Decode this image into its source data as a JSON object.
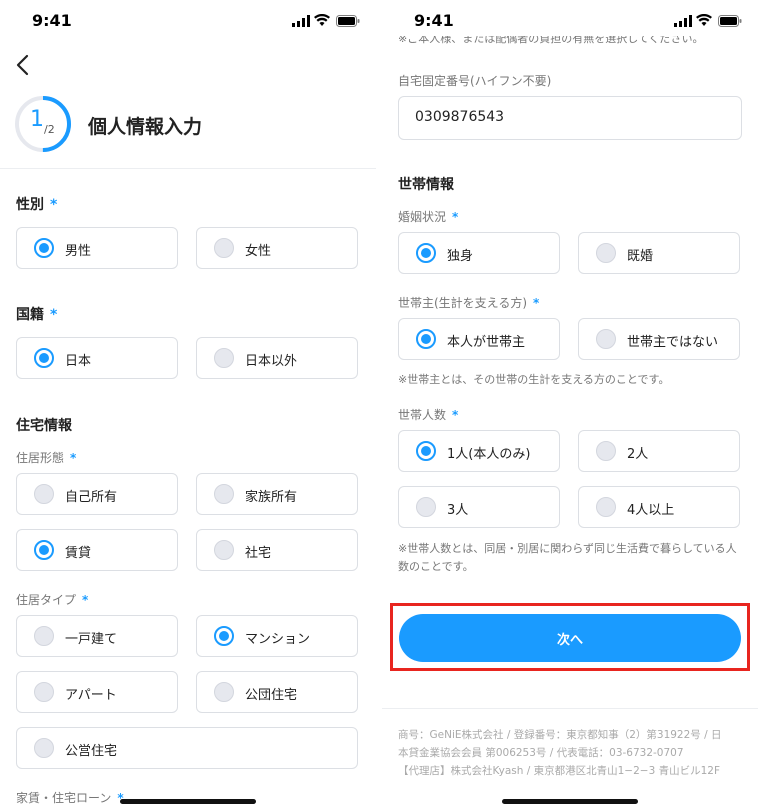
{
  "status": {
    "time": "9:41"
  },
  "left": {
    "progress": {
      "current": "1",
      "total": "/2",
      "fraction": 0.5
    },
    "page_title": "個人情報入力",
    "gender": {
      "label": "性別",
      "required": "*",
      "options": [
        "男性",
        "女性"
      ],
      "selected": 0
    },
    "nationality": {
      "label": "国籍",
      "required": "*",
      "options": [
        "日本",
        "日本以外"
      ],
      "selected": 0
    },
    "housing_section": "住宅情報",
    "residence_form": {
      "label": "住居形態",
      "required": "*",
      "options": [
        "自己所有",
        "家族所有",
        "賃貸",
        "社宅"
      ],
      "selected": 2
    },
    "residence_type": {
      "label": "住居タイプ",
      "required": "*",
      "options": [
        "一戸建て",
        "マンション",
        "アパート",
        "公団住宅",
        "公営住宅"
      ],
      "selected": 1
    },
    "rent_label": "家賃・住宅ローン",
    "rent_required": "*"
  },
  "right": {
    "top_note": "※ご本人様、または配偶者の負担の有無を選択してください。",
    "phone": {
      "label": "自宅固定番号(ハイフン不要)",
      "value": "0309876543"
    },
    "household_section": "世帯情報",
    "marital": {
      "label": "婚姻状況",
      "required": "*",
      "options": [
        "独身",
        "既婚"
      ],
      "selected": 0
    },
    "householder": {
      "label": "世帯主(生計を支える方)",
      "required": "*",
      "options": [
        "本人が世帯主",
        "世帯主ではない"
      ],
      "selected": 0
    },
    "householder_note": "※世帯主とは、その世帯の生計を支える方のことです。",
    "household_count": {
      "label": "世帯人数",
      "required": "*",
      "options": [
        "1人(本人のみ)",
        "2人",
        "3人",
        "4人以上"
      ],
      "selected": 0
    },
    "household_note": "※世帯人数とは、同居・別居に関わらず同じ生活費で暮らしている人数のことです。",
    "next_button": "次へ",
    "footer": [
      "商号：GeNiE株式会社 / 登録番号：東京都知事（2）第31922号 / 日",
      "本貸金業協会会員 第006253号 / 代表電話：03-6732-0707",
      "【代理店】株式会社Kyash / 東京都港区北青山1−2−3 青山ビル12F"
    ]
  },
  "colors": {
    "accent": "#1a9bff",
    "highlight": "#e8251f"
  }
}
